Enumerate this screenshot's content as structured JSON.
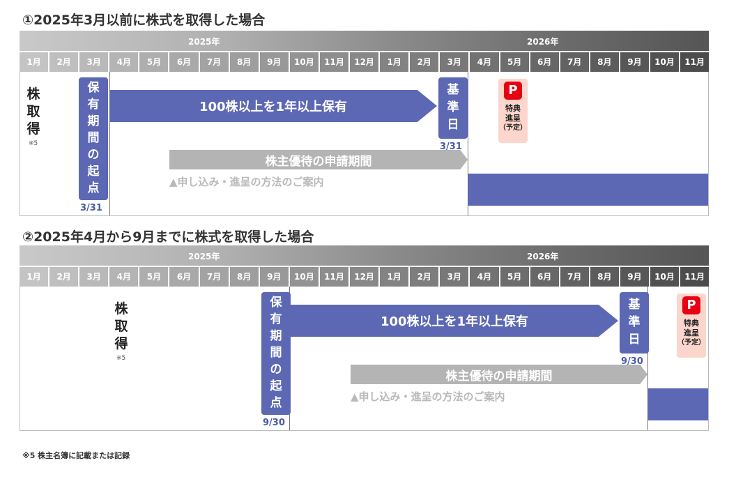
{
  "colors": {
    "accent_blue": "#5c68b4",
    "gray_arrow": "#b4b4b4",
    "perk_bg": "#fcd6cc",
    "perk_icon": "#e60012",
    "date_text": "#4a5aa8"
  },
  "scenario1": {
    "title": "①2025年3月以前に株式を取得した場合",
    "year_2025": "2025年",
    "year_2026": "2026年",
    "months": [
      "1月",
      "2月",
      "3月",
      "4月",
      "5月",
      "6月",
      "7月",
      "8月",
      "9月",
      "10月",
      "11月",
      "12月",
      "1月",
      "2月",
      "3月",
      "4月",
      "5月",
      "6月",
      "7月",
      "8月",
      "9月",
      "10月",
      "11月"
    ],
    "acquire_chars": [
      "株",
      "取",
      "得"
    ],
    "acquire_note": "※5",
    "start_chars": [
      "保",
      "有",
      "期",
      "間",
      "の",
      "起",
      "点"
    ],
    "start_date": "3/31",
    "hold_label": "100株以上を1年以上保有",
    "base_chars": [
      "基",
      "準",
      "日"
    ],
    "base_date": "3/31",
    "apply_label": "株主優待の申請期間",
    "apply_sub": "▲申し込み・進呈の方法のご案内",
    "perk_icon": "P",
    "perk_line1": "特典",
    "perk_line2": "進呈",
    "perk_line3": "（予定）"
  },
  "scenario2": {
    "title": "②2025年4月から9月までに株式を取得した場合",
    "year_2025": "2025年",
    "year_2026": "2026年",
    "months": [
      "1月",
      "2月",
      "3月",
      "4月",
      "5月",
      "6月",
      "7月",
      "8月",
      "9月",
      "10月",
      "11月",
      "12月",
      "1月",
      "2月",
      "3月",
      "4月",
      "5月",
      "6月",
      "7月",
      "8月",
      "9月",
      "10月",
      "11月"
    ],
    "acquire_chars": [
      "株",
      "取",
      "得"
    ],
    "acquire_note": "※5",
    "start_chars": [
      "保",
      "有",
      "期",
      "間",
      "の",
      "起",
      "点"
    ],
    "start_date": "9/30",
    "hold_label": "100株以上を1年以上保有",
    "base_chars": [
      "基",
      "準",
      "日"
    ],
    "base_date": "9/30",
    "apply_label": "株主優待の申請期間",
    "apply_sub": "▲申し込み・進呈の方法のご案内",
    "perk_icon": "P",
    "perk_line1": "特典",
    "perk_line2": "進呈",
    "perk_line3": "（予定）"
  },
  "footnote": "※5 株主名簿に記載または記録"
}
